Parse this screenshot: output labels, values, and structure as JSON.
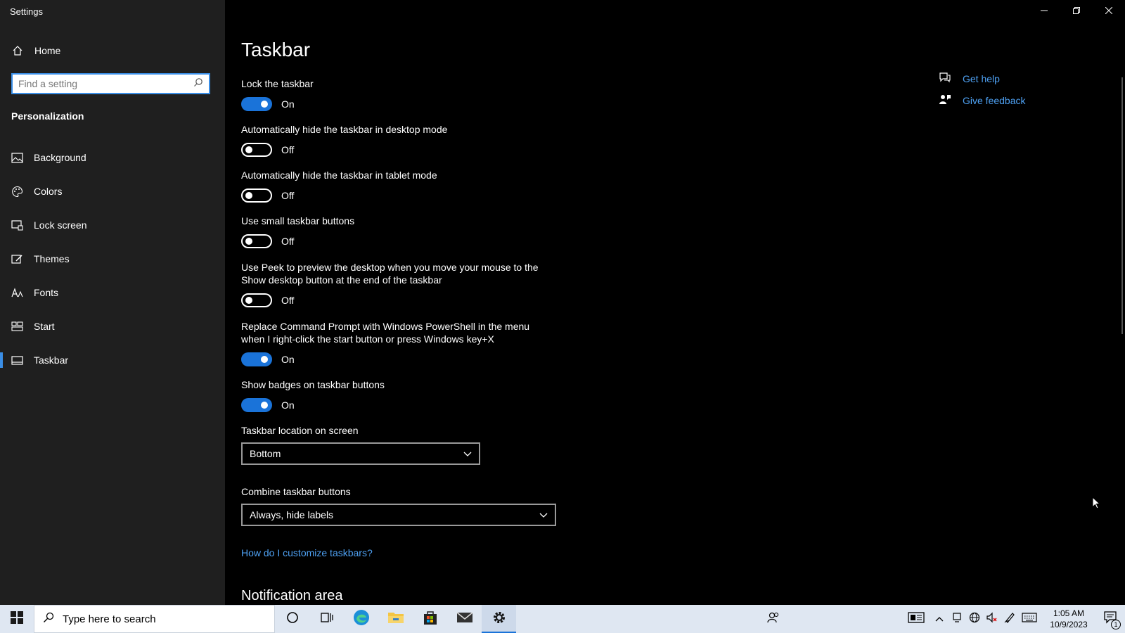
{
  "window": {
    "title": "Settings"
  },
  "sidebar": {
    "home_label": "Home",
    "search_placeholder": "Find a setting",
    "section": "Personalization",
    "items": [
      {
        "label": "Background",
        "icon": "image-icon"
      },
      {
        "label": "Colors",
        "icon": "palette-icon"
      },
      {
        "label": "Lock screen",
        "icon": "lock-screen-icon"
      },
      {
        "label": "Themes",
        "icon": "themes-icon"
      },
      {
        "label": "Fonts",
        "icon": "fonts-icon"
      },
      {
        "label": "Start",
        "icon": "start-icon"
      },
      {
        "label": "Taskbar",
        "icon": "taskbar-icon",
        "active": true
      }
    ]
  },
  "main": {
    "title": "Taskbar",
    "settings": [
      {
        "label": "Lock the taskbar",
        "state": "On"
      },
      {
        "label": "Automatically hide the taskbar in desktop mode",
        "state": "Off"
      },
      {
        "label": "Automatically hide the taskbar in tablet mode",
        "state": "Off"
      },
      {
        "label": "Use small taskbar buttons",
        "state": "Off"
      },
      {
        "label_line1": "Use Peek to preview the desktop when you move your mouse to the",
        "label_line2": "Show desktop button at the end of the taskbar",
        "state": "Off"
      },
      {
        "label_line1": "Replace Command Prompt with Windows PowerShell in the menu",
        "label_line2": "when I right-click the start button or press Windows key+X",
        "state": "On"
      },
      {
        "label": "Show badges on taskbar buttons",
        "state": "On"
      }
    ],
    "location": {
      "label": "Taskbar location on screen",
      "value": "Bottom"
    },
    "combine": {
      "label": "Combine taskbar buttons",
      "value": "Always, hide labels"
    },
    "help_link": "How do I customize taskbars?",
    "next_section": "Notification area"
  },
  "right_rail": {
    "get_help": "Get help",
    "give_feedback": "Give feedback"
  },
  "taskbar": {
    "search_placeholder": "Type here to search",
    "time": "1:05 AM",
    "date": "10/9/2023",
    "notification_count": "1"
  },
  "colors": {
    "accent": "#1a73d9",
    "link": "#4ea1f3",
    "sidebar_bg": "#1f1f1f"
  }
}
